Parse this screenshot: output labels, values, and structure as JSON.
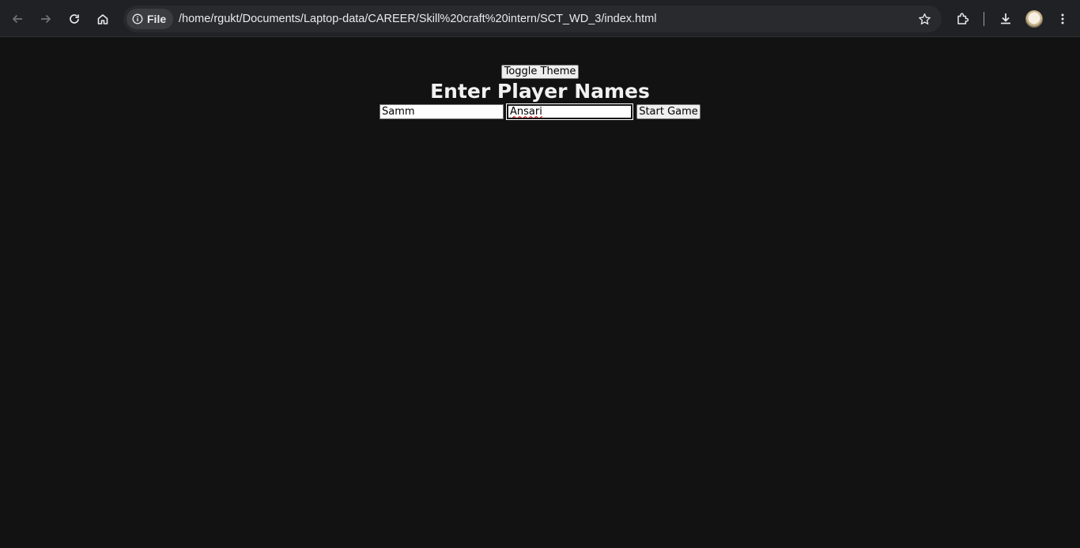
{
  "browser": {
    "scheme_label": "File",
    "url": "/home/rgukt/Documents/Laptop-data/CAREER/Skill%20craft%20intern/SCT_WD_3/index.html",
    "icons": [
      "back-arrow-icon",
      "forward-arrow-icon",
      "reload-icon",
      "home-icon",
      "info-icon",
      "star-icon",
      "extensions-icon",
      "download-icon",
      "avatar",
      "menu-kebab-icon"
    ]
  },
  "page": {
    "theme_button_label": "Toggle Theme",
    "title": "Enter Player Names",
    "player1_value": "Samm",
    "player2_value": "Ansari",
    "start_button_label": "Start Game"
  },
  "colors": {
    "page_background": "#121212",
    "toolbar_background": "#202124",
    "title_text": "#f1f1f1"
  }
}
